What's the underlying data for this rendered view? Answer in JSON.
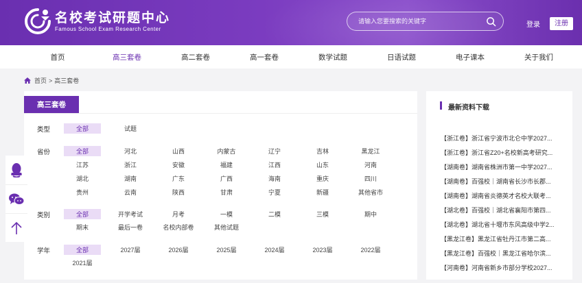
{
  "header": {
    "logo_cn": "名校考试研题中心",
    "logo_en": "Famous School Exam Research Center",
    "search_placeholder": "请输入您要搜索的关键字",
    "login": "登录",
    "register": "注册"
  },
  "nav": [
    "首页",
    "高三套卷",
    "高二套卷",
    "高一套卷",
    "数学试题",
    "日语试题",
    "电子课本",
    "关于我们"
  ],
  "breadcrumb": {
    "home": "首页",
    "sep": ">",
    "current": "高三套卷"
  },
  "panel": {
    "tab": "高三套卷",
    "type_label": "类型",
    "type_opts": [
      "全部",
      "试题"
    ],
    "prov_label": "省份",
    "prov_opts": [
      "全部",
      "河北",
      "山西",
      "内蒙古",
      "辽宁",
      "吉林",
      "黑龙江",
      "江苏",
      "浙江",
      "安徽",
      "福建",
      "江西",
      "山东",
      "河南",
      "湖北",
      "湖南",
      "广东",
      "广西",
      "海南",
      "重庆",
      "四川",
      "贵州",
      "云南",
      "陕西",
      "甘肃",
      "宁夏",
      "新疆",
      "其他省市"
    ],
    "cat_label": "类别",
    "cat_opts": [
      "全部",
      "开学考试",
      "月考",
      "一模",
      "二模",
      "三模",
      "期中",
      "期末",
      "最后一卷",
      "名校内部卷",
      "其他试题"
    ],
    "year_label": "学年",
    "year_opts": [
      "全部",
      "2027届",
      "2026届",
      "2025届",
      "2024届",
      "2023届",
      "2022届",
      "2021届"
    ]
  },
  "side_tools": [
    "qq-icon",
    "wechat-icon",
    "back-to-top-icon"
  ],
  "latest": {
    "title": "最新资料下载",
    "items": [
      "【浙江卷】浙江省宁波市北仑中学2027...",
      "【浙江卷】浙江省Z20+名校新高考研究...",
      "【湖南卷】湖南省株洲市第一中学2027...",
      "【湖南卷】百强校｜湖南省长沙市长郡...",
      "【湖南卷】湖南省炎德英才名校大联考...",
      "【湖北卷】百强校｜湖北省襄阳市第四...",
      "【湖北卷】湖北省十堰市东风高级中学2...",
      "【黑龙江卷】黑龙江省牡丹江市第二高...",
      "【黑龙江卷】百强校｜黑龙江省哈尔滨...",
      "【河南卷】河南省新乡市部分学校2027..."
    ]
  },
  "colors": {
    "brand": "#6a2fb0",
    "active_bg": "#eadcf6"
  }
}
